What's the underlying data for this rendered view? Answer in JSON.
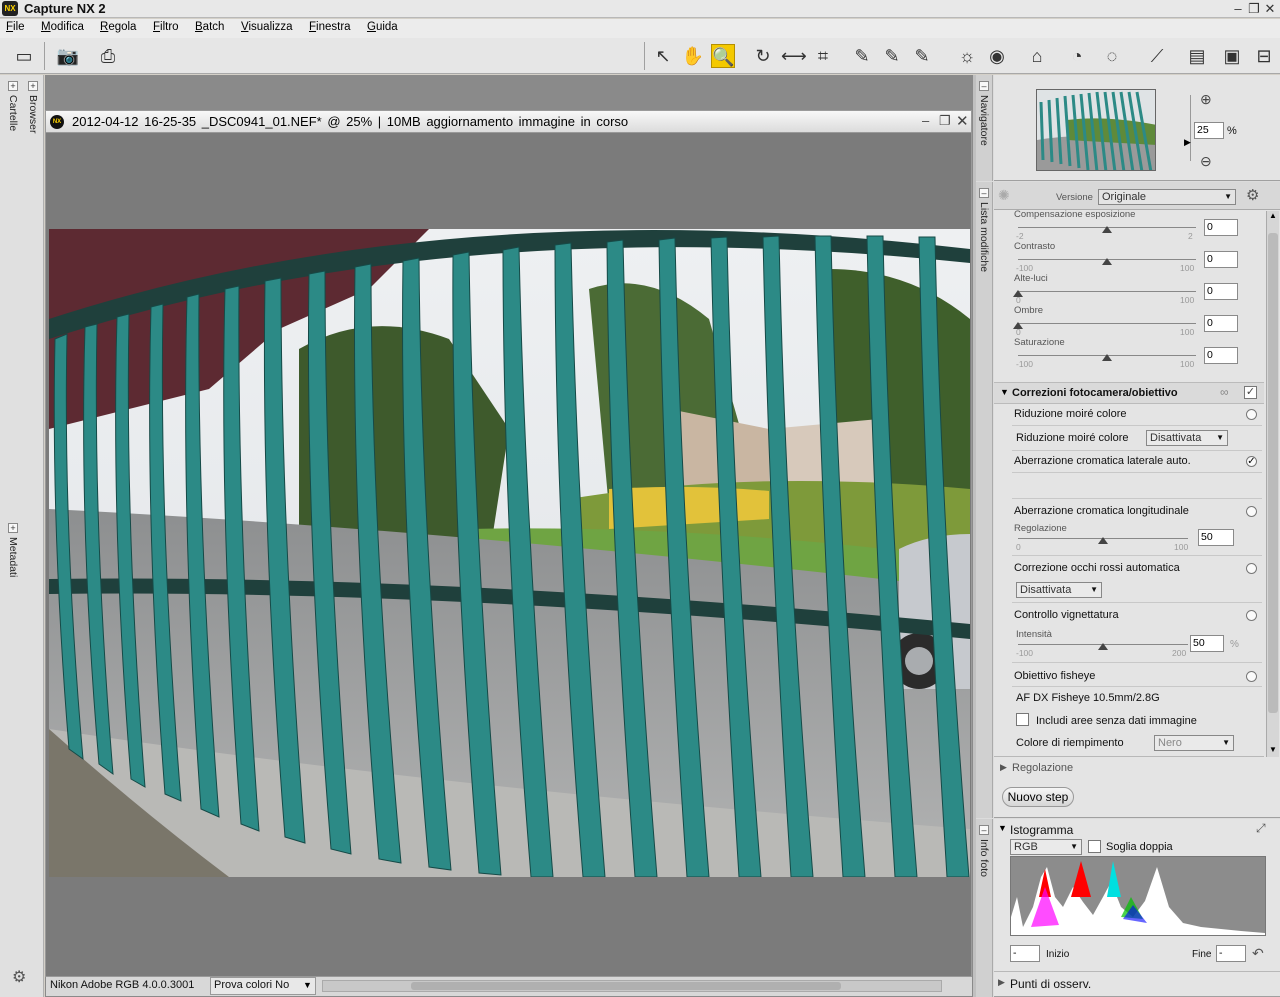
{
  "app": {
    "title": "Capture NX 2"
  },
  "menu": [
    "File",
    "Modifica",
    "Regola",
    "Filtro",
    "Batch",
    "Visualizza",
    "Finestra",
    "Guida"
  ],
  "left_tabs": {
    "folders": "Cartelle",
    "browser": "Browser",
    "metadata": "Metadati"
  },
  "document": {
    "title": "2012-04-12  16-25-35  _DSC0941_01.NEF* @ 25% | 10MB  aggiornamento  immagine  in  corso"
  },
  "statusbar": {
    "profile": "Nikon Adobe RGB 4.0.0.3001",
    "proof": "Prova colori No"
  },
  "navigator": {
    "tab": "Navigatore",
    "zoom": "25",
    "unit": "%"
  },
  "edits": {
    "tab": "Lista modifiche",
    "version_label": "Versione",
    "version_value": "Originale",
    "sliders": [
      {
        "label": "Compensazione esposizione",
        "min": "-2",
        "max": "2",
        "value": "0",
        "pos": 0.5
      },
      {
        "label": "Contrasto",
        "min": "-100",
        "max": "100",
        "value": "0",
        "pos": 0.5
      },
      {
        "label": "Alte-luci",
        "min": "0",
        "max": "100",
        "value": "0",
        "pos": 0.0
      },
      {
        "label": "Ombre",
        "min": "0",
        "max": "100",
        "value": "0",
        "pos": 0.0
      },
      {
        "label": "Saturazione",
        "min": "-100",
        "max": "100",
        "value": "0",
        "pos": 0.5
      }
    ],
    "section_title": "Correzioni fotocamera/obiettivo",
    "moire_title": "Riduzione moiré colore",
    "moire_label": "Riduzione moiré colore",
    "moire_value": "Disattivata",
    "lat_ca": "Aberrazione cromatica laterale auto.",
    "long_ca": "Aberrazione cromatica longitudinale",
    "long_ca_sub": "Regolazione",
    "long_ca_min": "0",
    "long_ca_max": "100",
    "long_ca_value": "50",
    "long_ca_pos": 0.5,
    "redeye": "Correzione occhi rossi automatica",
    "redeye_value": "Disattivata",
    "vignette": "Controllo vignettatura",
    "vignette_sub": "Intensità",
    "vignette_min": "-100",
    "vignette_max": "200",
    "vignette_value": "50",
    "vignette_unit": "%",
    "vignette_pos": 0.5,
    "fisheye": "Obiettivo fisheye",
    "fisheye_lens": "AF DX Fisheye 10.5mm/2.8G",
    "fisheye_include": "Includi aree senza dati immagine",
    "fill_label": "Colore di riempimento",
    "fill_value": "Nero",
    "regolazione": "Regolazione",
    "new_step": "Nuovo step"
  },
  "histogram": {
    "tab": "Info foto",
    "title": "Istogramma",
    "channel": "RGB",
    "double_threshold": "Soglia doppia",
    "start_label": "Inizio",
    "end_label": "Fine",
    "start_value": "-",
    "end_value": "-"
  },
  "points": {
    "title": "Punti di osserv."
  },
  "colors": {
    "accent": "#f4c900",
    "fence": "#2e8b86",
    "panel": "#e4e4e4"
  }
}
